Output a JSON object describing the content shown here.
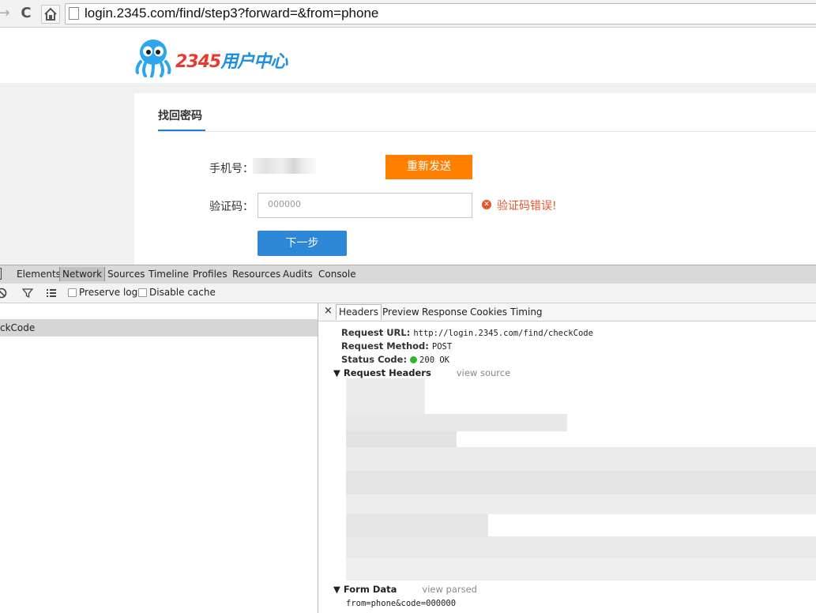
{
  "browser": {
    "url": "login.2345.com/find/step3?forward=&from=phone"
  },
  "site": {
    "logo_brand_num": "2345",
    "logo_brand_text": "用户中心",
    "tab_title": "找回密码",
    "phone_label": "手机号：",
    "resend_label": "重新发送",
    "code_label": "验证码：",
    "code_value": "000000",
    "error_text": "验证码错误!",
    "next_label": "下一步",
    "colors": {
      "accent_orange": "#ff8000",
      "accent_blue": "#2e86d6",
      "error": "#e4572e"
    }
  },
  "devtools": {
    "tabs": [
      "Elements",
      "Network",
      "Sources",
      "Timeline",
      "Profiles",
      "Resources",
      "Audits",
      "Console"
    ],
    "active_tab": "Network",
    "toolbar": {
      "preserve_log": "Preserve log",
      "disable_cache": "Disable cache"
    },
    "request_name": "ckCode",
    "detail_tabs": [
      "Headers",
      "Preview",
      "Response",
      "Cookies",
      "Timing"
    ],
    "general": {
      "request_url_key": "Request URL:",
      "request_url": "http://login.2345.com/find/checkCode",
      "method_key": "Request Method:",
      "method": "POST",
      "status_key": "Status Code:",
      "status": "200 OK"
    },
    "request_headers": {
      "title": "Request Headers",
      "link": "view source"
    },
    "form_data": {
      "title": "Form Data",
      "link": "view parsed",
      "value": "from=phone&code=000000"
    }
  }
}
